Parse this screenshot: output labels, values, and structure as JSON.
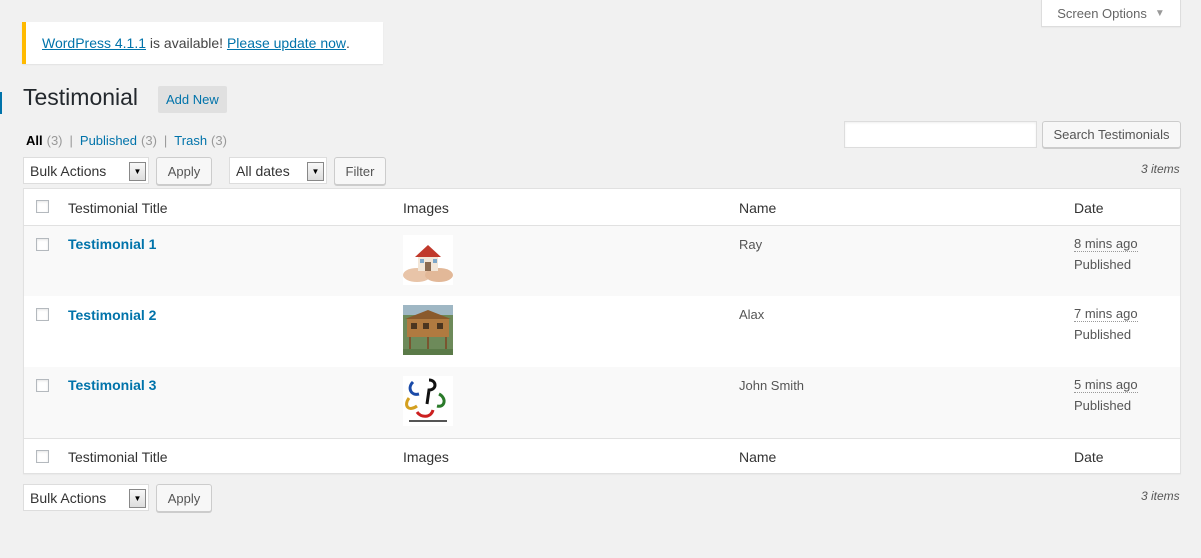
{
  "screen_options": {
    "label": "Screen Options"
  },
  "notice": {
    "version_link": "WordPress 4.1.1",
    "middle_text": " is available! ",
    "update_link": "Please update now",
    "end": "."
  },
  "page": {
    "title": "Testimonial",
    "add_new": "Add New"
  },
  "filters": {
    "all": {
      "label": "All",
      "count": "(3)"
    },
    "published": {
      "label": "Published",
      "count": "(3)"
    },
    "trash": {
      "label": "Trash",
      "count": "(3)"
    },
    "separator": "|"
  },
  "search": {
    "value": "",
    "button": "Search Testimonials"
  },
  "toolbar_top": {
    "bulk_actions": "Bulk Actions",
    "apply": "Apply",
    "dates": "All dates",
    "filter": "Filter",
    "items": "3 items"
  },
  "toolbar_bottom": {
    "bulk_actions": "Bulk Actions",
    "apply": "Apply",
    "items": "3 items"
  },
  "columns": {
    "title": "Testimonial Title",
    "images": "Images",
    "name": "Name",
    "date": "Date"
  },
  "rows": [
    {
      "title": "Testimonial 1",
      "name": "Ray",
      "ago": "8 mins ago",
      "status": "Published",
      "image": "house-in-hands-image"
    },
    {
      "title": "Testimonial 2",
      "name": "Alax",
      "ago": "7 mins ago",
      "status": "Published",
      "image": "wooden-house-image"
    },
    {
      "title": "Testimonial 3",
      "name": "John Smith",
      "ago": "5 mins ago",
      "status": "Published",
      "image": "colorful-logo-image"
    }
  ],
  "colors": {
    "link": "#0073aa",
    "notice_border": "#ffba00",
    "background": "#f1f1f1"
  }
}
